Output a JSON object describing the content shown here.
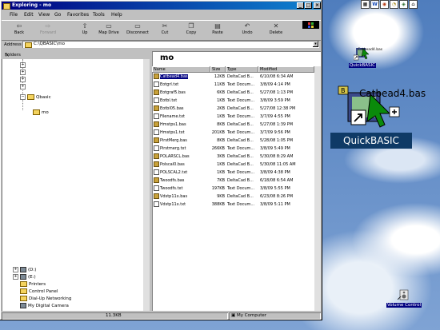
{
  "window": {
    "title": "Exploring - mo"
  },
  "menu": [
    "File",
    "Edit",
    "View",
    "Go",
    "Favorites",
    "Tools",
    "Help"
  ],
  "toolbar": [
    {
      "label": "Back",
      "icon": "back-arrow-icon",
      "disabled": false
    },
    {
      "label": "Forward",
      "icon": "forward-arrow-icon",
      "disabled": true
    },
    {
      "label": "Up",
      "icon": "up-folder-icon",
      "disabled": false
    },
    {
      "label": "Map Drive",
      "icon": "map-drive-icon",
      "disabled": false
    },
    {
      "label": "Disconnect",
      "icon": "disconnect-icon",
      "disabled": false
    },
    {
      "label": "Cut",
      "icon": "scissors-icon",
      "disabled": false
    },
    {
      "label": "Copy",
      "icon": "copy-icon",
      "disabled": false
    },
    {
      "label": "Paste",
      "icon": "paste-icon",
      "disabled": false
    },
    {
      "label": "Undo",
      "icon": "undo-icon",
      "disabled": false
    },
    {
      "label": "Delete",
      "icon": "delete-x-icon",
      "disabled": false
    }
  ],
  "address": {
    "label": "Address",
    "value": "C:\\QBASIC\\mo"
  },
  "folders": {
    "header": "Folders",
    "tree_top": [
      {
        "label": "Qbasic",
        "type": "folder-open"
      },
      {
        "label": "mo",
        "type": "folder"
      }
    ],
    "tree_bottom": [
      {
        "label": "(D:)",
        "type": "drive"
      },
      {
        "label": "(E:)",
        "type": "drive"
      },
      {
        "label": "Printers",
        "type": "special"
      },
      {
        "label": "Control Panel",
        "type": "special"
      },
      {
        "label": "Dial-Up Networking",
        "type": "special"
      },
      {
        "label": "My Digital Camera",
        "type": "special"
      }
    ]
  },
  "content": {
    "title": "mo",
    "columns": [
      "Name",
      "Size",
      "Type",
      "Modified"
    ],
    "files": [
      {
        "name": "Catbead4.bas",
        "size": "12KB",
        "type": "DeltaCad B...",
        "modified": "6/10/08 6:34 AM",
        "kind": "bas",
        "selected": true
      },
      {
        "name": "Eotgrl.txt",
        "size": "11KB",
        "type": "Text Docum...",
        "modified": "3/8/09 4:14 PM",
        "kind": "txt"
      },
      {
        "name": "Eotgraf5.bas",
        "size": "6KB",
        "type": "DeltaCad B...",
        "modified": "5/27/08 1:13 PM",
        "kind": "bas"
      },
      {
        "name": "Eotbl.txt",
        "size": "1KB",
        "type": "Text Docum...",
        "modified": "3/8/09 3:59 PM",
        "kind": "txt"
      },
      {
        "name": "Eotbl05.bas",
        "size": "2KB",
        "type": "DeltaCad B...",
        "modified": "5/27/08 12:38 PM",
        "kind": "bas"
      },
      {
        "name": "Filename.txt",
        "size": "1KB",
        "type": "Text Docum...",
        "modified": "3/7/09 4:55 PM",
        "kind": "txt"
      },
      {
        "name": "Hmstps1.bas",
        "size": "8KB",
        "type": "DeltaCad B...",
        "modified": "5/27/08 1:39 PM",
        "kind": "bas"
      },
      {
        "name": "Hmstps1.txt",
        "size": "201KB",
        "type": "Text Docum...",
        "modified": "3/7/09 9:56 PM",
        "kind": "txt"
      },
      {
        "name": "PirstMerg.bas",
        "size": "8KB",
        "type": "DeltaCad B...",
        "modified": "5/28/08 1:05 PM",
        "kind": "bas"
      },
      {
        "name": "Pirstmerg.txt",
        "size": "266KB",
        "type": "Text Docum...",
        "modified": "3/8/09 5:49 PM",
        "kind": "txt"
      },
      {
        "name": "POLARSCL.bas",
        "size": "3KB",
        "type": "DeltaCad B...",
        "modified": "5/30/08 8:29 AM",
        "kind": "bas"
      },
      {
        "name": "Polscal0.bas",
        "size": "1KB",
        "type": "DeltaCad B...",
        "modified": "5/30/08 11:05 AM",
        "kind": "bas"
      },
      {
        "name": "POLSCAL2.txt",
        "size": "1KB",
        "type": "Text Docum...",
        "modified": "3/8/09 4:38 PM",
        "kind": "txt"
      },
      {
        "name": "Twoodfs.bas",
        "size": "7KB",
        "type": "DeltaCad B...",
        "modified": "6/18/08 6:54 AM",
        "kind": "bas"
      },
      {
        "name": "Twoodfs.txt",
        "size": "197KB",
        "type": "Text Docum...",
        "modified": "3/8/09 5:55 PM",
        "kind": "txt"
      },
      {
        "name": "Vdstp11x.bas",
        "size": "9KB",
        "type": "DeltaCad B...",
        "modified": "6/23/08 8:26 PM",
        "kind": "bas"
      },
      {
        "name": "Vdstp11x.txt",
        "size": "388KB",
        "type": "Text Docum...",
        "modified": "3/8/09 5:11 PM",
        "kind": "txt"
      }
    ]
  },
  "status": {
    "size": "11.3KB",
    "location": "My Computer"
  },
  "desktop": {
    "small_icon_label": "QuickBASIC",
    "big_icon_label": "QuickBASIC",
    "big_icon_overlay_text": "Catbead4.bas",
    "small_icon_overlay_text": "Catbead4.bas",
    "volume_label": "Volume Control"
  }
}
